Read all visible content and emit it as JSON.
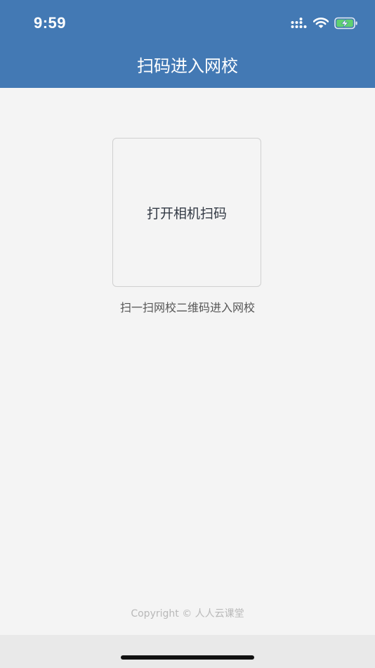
{
  "status_bar": {
    "time": "9:59",
    "icons": [
      "cellular-signal-icon",
      "wifi-icon",
      "battery-charging-icon"
    ],
    "battery_color": "#5fd070"
  },
  "header": {
    "title": "扫码进入网校",
    "background": "#4379b4"
  },
  "scan": {
    "button_label": "打开相机扫码",
    "hint": "扫一扫网校二维码进入网校"
  },
  "footer": {
    "copyright": "Copyright © 人人云课堂"
  }
}
